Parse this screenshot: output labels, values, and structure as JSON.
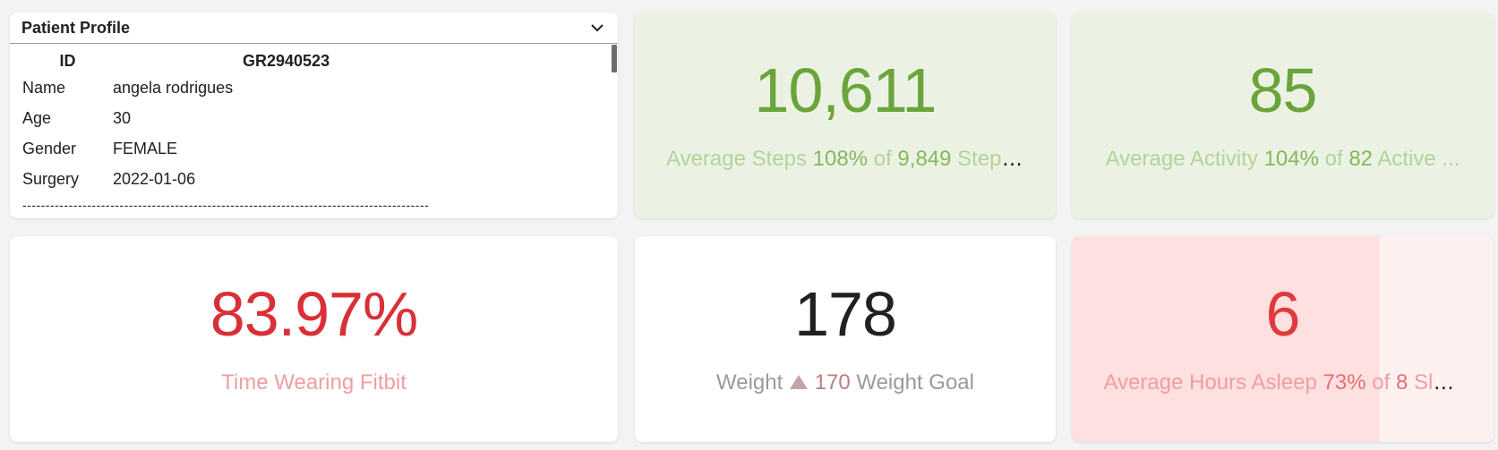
{
  "profile": {
    "title": "Patient Profile",
    "headers": {
      "key": "ID",
      "value": "GR2940523"
    },
    "rows": [
      {
        "key": "Name",
        "value": "angela rodrigues"
      },
      {
        "key": "Age",
        "value": "30"
      },
      {
        "key": "Gender",
        "value": "FEMALE"
      },
      {
        "key": "Surgery",
        "value": "2022-01-06"
      }
    ],
    "divider": "----------------------------------------------------------------------------------------"
  },
  "steps": {
    "value": "10,611",
    "label": "Average Steps",
    "pct": "108%",
    "of": "of",
    "target": "9,849",
    "target_label": "Steps ..."
  },
  "activity": {
    "value": "85",
    "label": "Average Activity",
    "pct": "104%",
    "of": "of",
    "target": "82",
    "target_label": "Active ..."
  },
  "fitbit": {
    "value": "83.97%",
    "label": "Time Wearing Fitbit"
  },
  "weight": {
    "value": "178",
    "label": "Weight",
    "goal_value": "170",
    "goal_label": "Weight Goal",
    "indicator_icon": "triangle-up-icon"
  },
  "sleep": {
    "value": "6",
    "label": "Average Hours Asleep",
    "pct": "73%",
    "of": "of",
    "target": "8",
    "target_label": "Sle...",
    "progress_fraction": 0.73
  },
  "colors": {
    "green": "#6aa43a",
    "red": "#d93037",
    "tile_green_bg": "#ebf2e3",
    "tile_red_bg": "#fbe4e3"
  }
}
